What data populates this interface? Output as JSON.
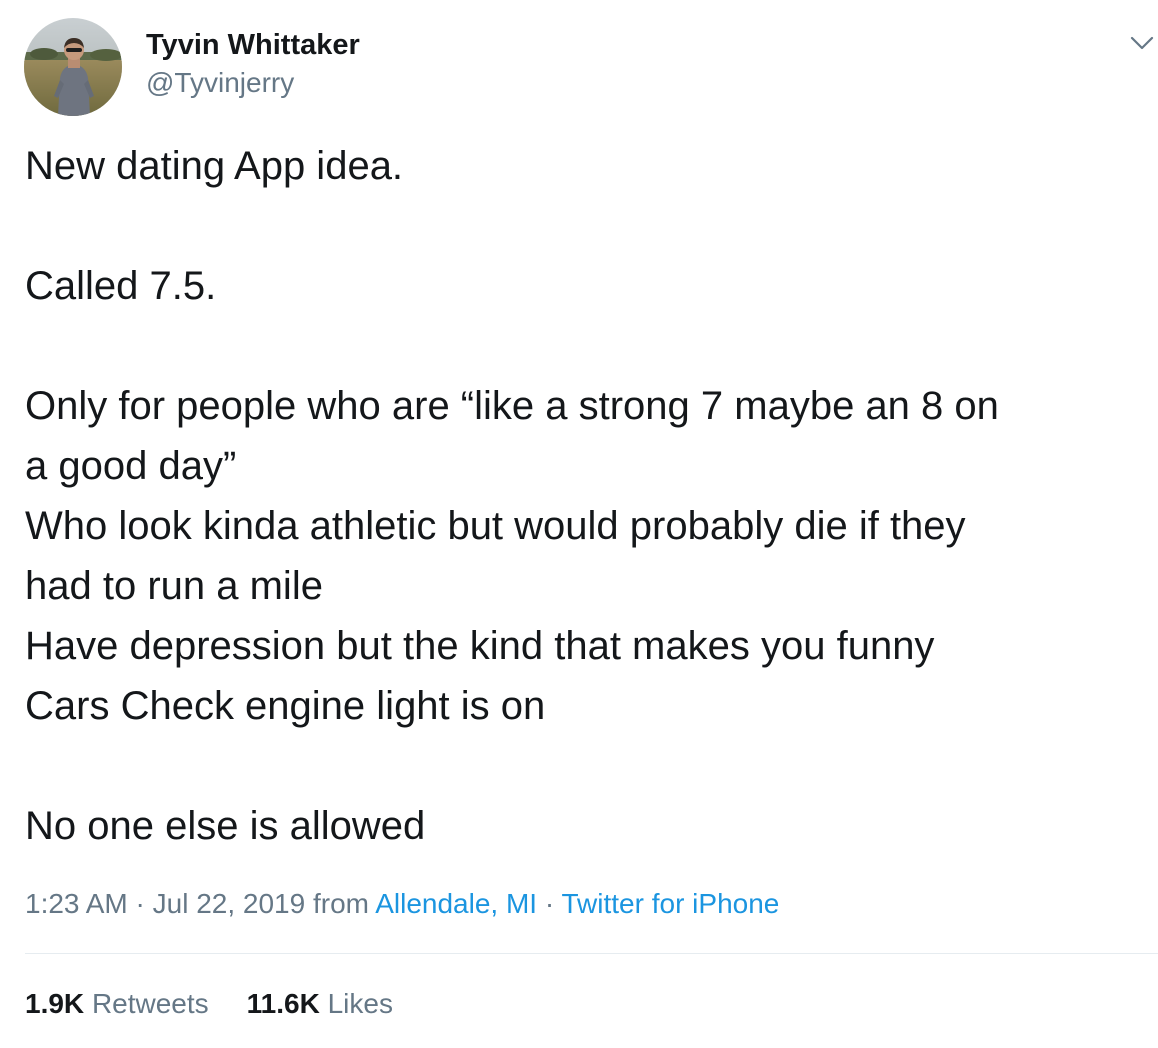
{
  "author": {
    "display_name": "Tyvin Whittaker",
    "handle": "@Tyvinjerry"
  },
  "menu": {
    "icon": "chevron-down-icon"
  },
  "tweet": {
    "lines": [
      "New dating App idea.",
      "",
      "Called 7.5.",
      "",
      "Only for people who are “like a strong 7 maybe an 8 on",
      "a good day”",
      "Who look kinda athletic but would probably die if they",
      "had to run a mile",
      "Have depression but the kind that makes you funny",
      "Cars Check engine light is on",
      "",
      "No one else is allowed"
    ]
  },
  "meta": {
    "time": "1:23 AM",
    "separator": " · ",
    "date": "Jul 22, 2019",
    "from_label": " from ",
    "location": "Allendale, MI",
    "source": "Twitter for iPhone"
  },
  "stats": {
    "retweets_count": "1.9K",
    "retweets_label": "Retweets",
    "likes_count": "11.6K",
    "likes_label": "Likes"
  },
  "colors": {
    "text": "#14171a",
    "secondary": "#657786",
    "link": "#1b95e0",
    "divider": "#e6ecf0"
  }
}
